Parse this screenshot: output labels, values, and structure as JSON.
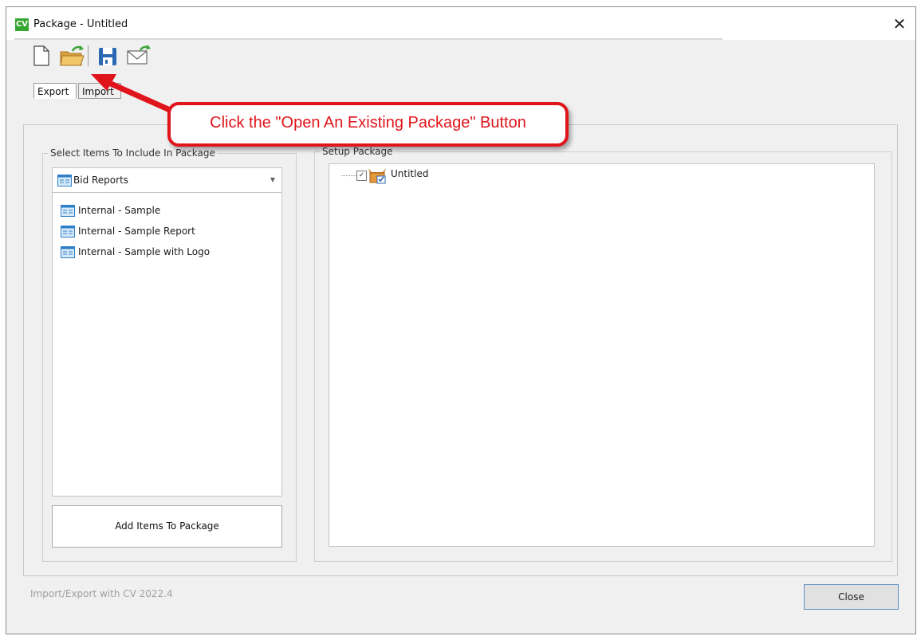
{
  "window": {
    "app_logo": "CV",
    "title": "Package - Untitled",
    "close_glyph": "✕"
  },
  "toolbar": {
    "buttons": [
      {
        "name": "new-package-button",
        "icon": "new-document-icon"
      },
      {
        "name": "open-package-button",
        "icon": "open-folder-icon"
      },
      {
        "name": "save-package-button",
        "icon": "floppy-disk-icon"
      },
      {
        "name": "email-package-button",
        "icon": "envelope-icon"
      }
    ]
  },
  "tabs": [
    {
      "label": "Export",
      "active": true
    },
    {
      "label": "Import",
      "active": false
    }
  ],
  "left_group": {
    "legend": "Select Items To Include In Package",
    "dropdown": {
      "selected": "Bid Reports",
      "icon": "report-icon"
    },
    "items": [
      {
        "label": "Internal - Sample",
        "icon": "report-icon"
      },
      {
        "label": "Internal - Sample Report",
        "icon": "report-icon"
      },
      {
        "label": "Internal - Sample with Logo",
        "icon": "report-icon"
      }
    ],
    "add_button_label": "Add Items To Package"
  },
  "right_group": {
    "legend": "Setup Package",
    "tree": [
      {
        "label": "Untitled",
        "checked": true,
        "icon": "package-icon"
      }
    ]
  },
  "footer": {
    "version_text": "Import/Export with CV 2022.4",
    "close_label": "Close"
  },
  "annotation": {
    "callout_text": "Click the \"Open An Existing Package\" Button",
    "color": "#e0141b"
  },
  "colors": {
    "window_bg": "#f0f0f0",
    "accent_logo": "#36a832",
    "close_button_border": "#5f8fc4"
  }
}
